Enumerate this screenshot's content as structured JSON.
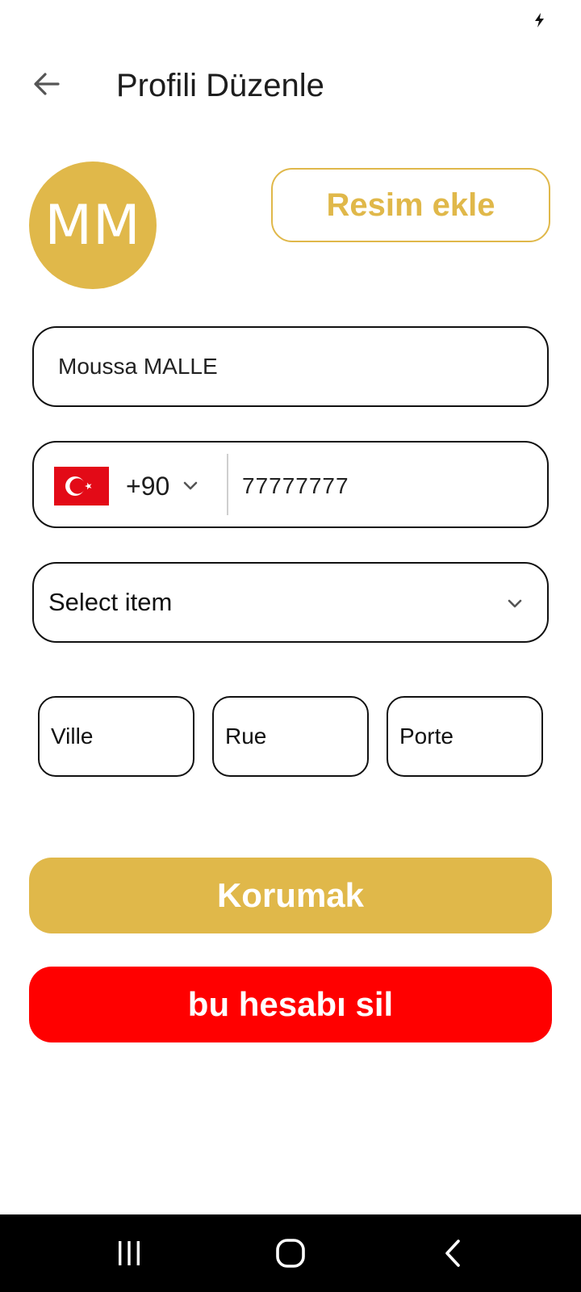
{
  "header": {
    "title": "Profili Düzenle",
    "back_icon": "arrow-left-icon"
  },
  "avatar": {
    "initials": "MM",
    "color": "#e0b84a"
  },
  "add_photo": {
    "label": "Resim ekle"
  },
  "form": {
    "name_value": "Moussa MALLE",
    "phone": {
      "country_flag": "turkey-flag-icon",
      "country_code": "+90",
      "number": "77777777"
    },
    "select": {
      "value": "Select item"
    },
    "address": {
      "ville_placeholder": "Ville",
      "rue_placeholder": "Rue",
      "porte_placeholder": "Porte"
    }
  },
  "actions": {
    "save_label": "Korumak",
    "save_color": "#e0b84a",
    "delete_label": "bu hesabı sil",
    "delete_color": "#ff0000"
  },
  "nav_bar": {
    "recents_icon": "recents-icon",
    "home_icon": "home-icon",
    "back_icon": "back-chevron-icon"
  }
}
